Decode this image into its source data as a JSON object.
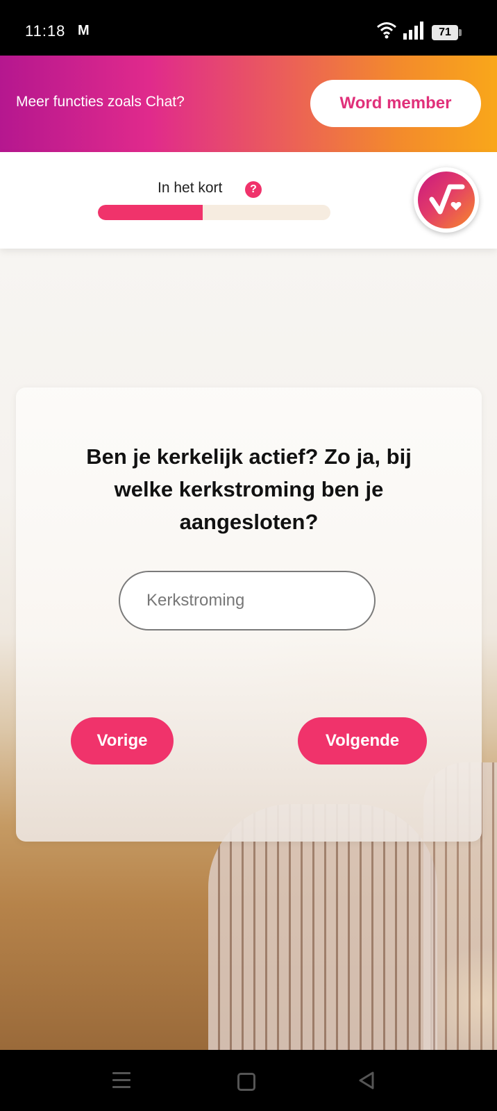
{
  "status_bar": {
    "time": "11:18",
    "mail_icon": "M",
    "battery": "71"
  },
  "promo": {
    "text": "Meer functies zoals Chat?",
    "button_label": "Word member"
  },
  "header": {
    "progress_label": "In het kort",
    "help_icon": "?",
    "progress_fraction": 0.45
  },
  "question": {
    "text": "Ben je kerkelijk actief? Zo ja, bij welke kerkstroming ben je aangesloten?",
    "input_placeholder": "Kerkstroming",
    "input_value": "",
    "prev_label": "Vorige",
    "next_label": "Volgende"
  },
  "colors": {
    "accent": "#f0336b",
    "promo_gradient_start": "#b5178f",
    "promo_gradient_end": "#f9a71a"
  }
}
